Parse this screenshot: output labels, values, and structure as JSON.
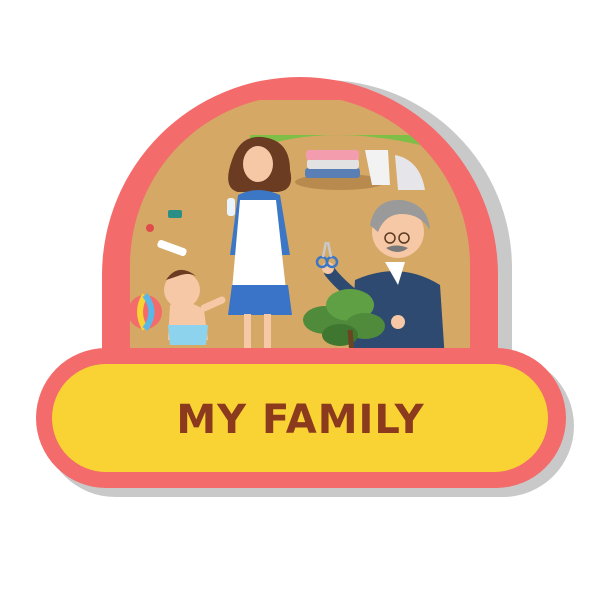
{
  "badge": {
    "title": "MY FAMILY"
  },
  "colors": {
    "frame": "#f36b6b",
    "frame_shadow": "#c9c9c9",
    "banner_fill": "#f9d334",
    "scene_ground": "#d5a865",
    "scene_grass": "#7dbf47",
    "title_text": "#8b3a1e"
  },
  "scene": {
    "figures": [
      "mother-with-bottle",
      "baby-sitting",
      "grandfather-with-scissors"
    ],
    "props": [
      "beach-ball",
      "folded-laundry",
      "scattered-toys",
      "bonsai-plant"
    ]
  }
}
